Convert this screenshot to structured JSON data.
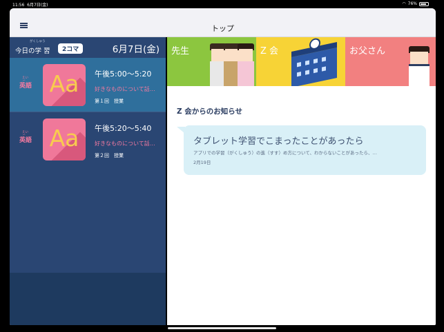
{
  "status_bar": {
    "time": "11:56",
    "date": "6月7日(金)",
    "battery": "76%",
    "battery_level": 0.76
  },
  "nav": {
    "title": "トップ"
  },
  "left_panel": {
    "header": {
      "title": "今日の学 習",
      "furigana": "がくしゅう",
      "count": "2コマ",
      "date": "6月7日(金)"
    },
    "lessons": [
      {
        "subject": "英語",
        "subject_ruby": "えい ご",
        "icon_text": "Aa",
        "time": "午後5:00〜5:20",
        "description": "好きなものについて話…",
        "meta": "第１回　授業"
      },
      {
        "subject": "英語",
        "subject_ruby": "えい ご",
        "icon_text": "Aa",
        "time": "午後5:20〜5:40",
        "description": "好きなものについて話…",
        "meta": "第２回　授業"
      }
    ]
  },
  "banners": [
    {
      "label": "先生"
    },
    {
      "label": "Z 会"
    },
    {
      "label": "お父さん"
    }
  ],
  "news": {
    "title": "Z 会からのお知らせ",
    "items": [
      {
        "headline": "タブレット学習でこまったことがあったら",
        "body": "アプリでの学習（がくしゅう）の進（すす）め方について、わからないことがあったら、…",
        "date": "2月19日"
      }
    ]
  },
  "colors": {
    "left_bg": "#1e3a5f",
    "lesson_active": "#2f6f9c",
    "accent_pink": "#f47aa0",
    "bubble_bg": "#d9f0f7"
  }
}
